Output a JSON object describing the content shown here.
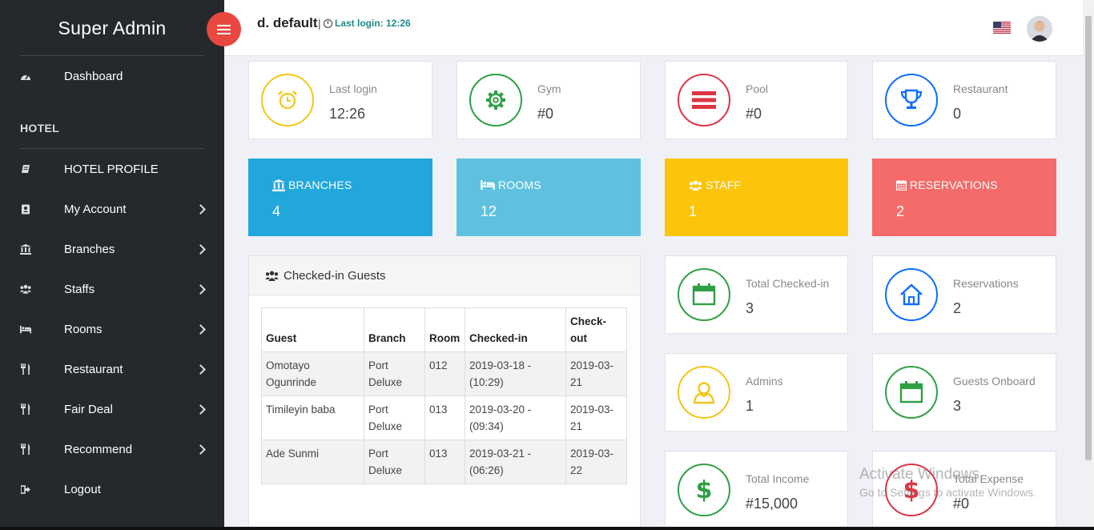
{
  "sidebar": {
    "brand": "Super Admin",
    "dashboard": "Dashboard",
    "section": "HOTEL",
    "items": [
      {
        "label": "HOTEL PROFILE",
        "icon": "book-icon"
      },
      {
        "label": "My Account",
        "icon": "contact-book-icon"
      },
      {
        "label": "Branches",
        "icon": "bank-icon"
      },
      {
        "label": "Staffs",
        "icon": "users-icon"
      },
      {
        "label": "Rooms",
        "icon": "bed-icon"
      },
      {
        "label": "Restaurant",
        "icon": "utensils-icon"
      },
      {
        "label": "Fair Deal",
        "icon": "utensils-icon"
      },
      {
        "label": "Recommend",
        "icon": "utensils-icon"
      },
      {
        "label": "Logout",
        "icon": "sign-out-icon"
      }
    ]
  },
  "topbar": {
    "user": "d. default",
    "separator": "|",
    "last_login": "Last login: 12:26"
  },
  "stats_top": [
    {
      "label": "Last login",
      "value": "12:26",
      "color": "#f5c518",
      "icon": "alarm-clock-icon"
    },
    {
      "label": "Gym",
      "value": "#0",
      "color": "#2ea043",
      "icon": "gear-icon"
    },
    {
      "label": "Pool",
      "value": "#0",
      "color": "#dc3545",
      "icon": "bars-icon"
    },
    {
      "label": "Restaurant",
      "value": "0",
      "color": "#0d6efd",
      "icon": "trophy-icon"
    }
  ],
  "color_cards": [
    {
      "label": "BRANCHES",
      "value": "4",
      "color": "#22a7dc"
    },
    {
      "label": "ROOMS",
      "value": "12",
      "color": "#5fc1df"
    },
    {
      "label": "STAFF",
      "value": "1",
      "color": "#fcc40a"
    },
    {
      "label": "RESERVATIONS",
      "value": "2",
      "color": "#f46b69"
    }
  ],
  "guests": {
    "title": "Checked-in Guests",
    "columns": [
      "Guest",
      "Branch",
      "Room",
      "Checked-in",
      "Check-out"
    ],
    "rows": [
      [
        "Omotayo Ogunrinde",
        "Port Deluxe",
        "012",
        "2019-03-18 - (10:29)",
        "2019-03-21"
      ],
      [
        "Timileyin baba",
        "Port Deluxe",
        "013",
        "2019-03-20 - (09:34)",
        "2019-03-21"
      ],
      [
        "Ade Sunmi",
        "Port Deluxe",
        "013",
        "2019-03-21 - (06:26)",
        "2019-03-22"
      ]
    ]
  },
  "stats_right": [
    {
      "label": "Total Checked-in",
      "value": "3",
      "color": "#2ea043",
      "icon": "calendar-icon"
    },
    {
      "label": "Reservations",
      "value": "2",
      "color": "#0d6efd",
      "icon": "home-icon"
    },
    {
      "label": "Admins",
      "value": "1",
      "color": "#f5c518",
      "icon": "user-icon"
    },
    {
      "label": "Guests Onboard",
      "value": "3",
      "color": "#2ea043",
      "icon": "calendar-icon"
    },
    {
      "label": "Total Income",
      "value": "#15,000",
      "color": "#2ea043",
      "icon": "dollar-icon"
    },
    {
      "label": "Total Expense",
      "value": "#0",
      "color": "#dc3545",
      "icon": "dollar-icon"
    }
  ],
  "watermark": {
    "line1": "Activate Windows",
    "line2": "Go to Settings to activate Windows."
  }
}
